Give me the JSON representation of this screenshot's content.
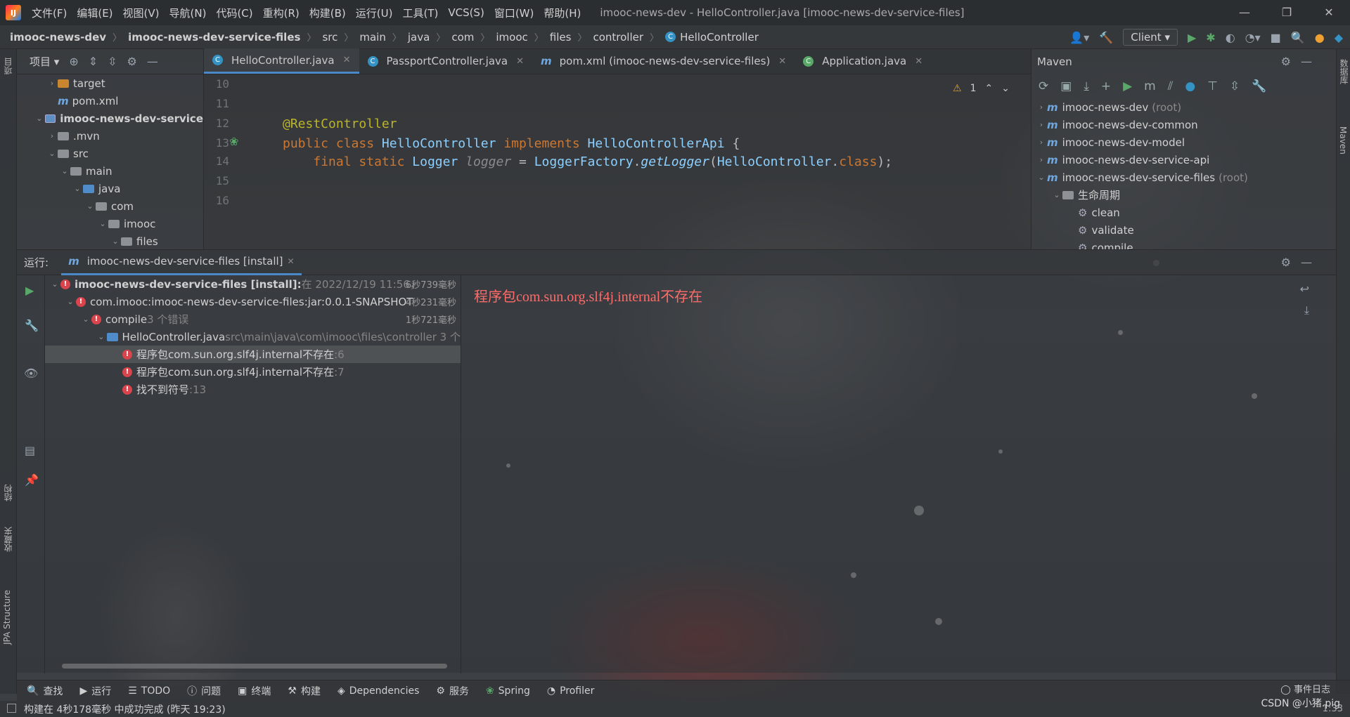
{
  "menubar": {
    "logo": "IJ",
    "items": [
      "文件(F)",
      "编辑(E)",
      "视图(V)",
      "导航(N)",
      "代码(C)",
      "重构(R)",
      "构建(B)",
      "运行(U)",
      "工具(T)",
      "VCS(S)",
      "窗口(W)",
      "帮助(H)"
    ],
    "title": "imooc-news-dev - HelloController.java [imooc-news-dev-service-files]"
  },
  "breadcrumb": [
    "imooc-news-dev",
    "imooc-news-dev-service-files",
    "src",
    "main",
    "java",
    "com",
    "imooc",
    "files",
    "controller",
    "HelloController"
  ],
  "run_config": "Client",
  "left_strip": {
    "project": "项目",
    "structure": "结构",
    "favorites": "收藏夹",
    "jpa": "JPA Structure"
  },
  "right_strip": {
    "database": "数据库",
    "maven": "Maven"
  },
  "project_panel": {
    "title": "项目",
    "rows": [
      {
        "label": "target",
        "icon": "folder-orange",
        "arrow": "›",
        "indent": 2
      },
      {
        "label": "pom.xml",
        "icon": "maven-file",
        "arrow": "",
        "indent": 2
      },
      {
        "label": "imooc-news-dev-service",
        "icon": "module-folder",
        "arrow": "⌄",
        "indent": 1
      },
      {
        "label": ".mvn",
        "icon": "folder-gray",
        "arrow": "›",
        "indent": 2
      },
      {
        "label": "src",
        "icon": "folder-gray",
        "arrow": "⌄",
        "indent": 2
      },
      {
        "label": "main",
        "icon": "folder-gray",
        "arrow": "⌄",
        "indent": 3
      },
      {
        "label": "java",
        "icon": "folder-blue",
        "arrow": "⌄",
        "indent": 4
      },
      {
        "label": "com",
        "icon": "folder-gray",
        "arrow": "⌄",
        "indent": 5
      },
      {
        "label": "imooc",
        "icon": "folder-gray",
        "arrow": "⌄",
        "indent": 6
      },
      {
        "label": "files",
        "icon": "folder-gray",
        "arrow": "⌄",
        "indent": 7
      }
    ]
  },
  "editor": {
    "tabs": [
      "HelloController.java",
      "PassportController.java",
      "pom.xml (imooc-news-dev-service-files)",
      "Application.java"
    ],
    "line_numbers": [
      "10",
      "11",
      "12",
      "13",
      "14",
      "15",
      "16"
    ],
    "code": {
      "annotation": "@RestController",
      "l13_kw1": "public",
      "l13_kw2": "class",
      "l13_name": "HelloController",
      "l13_kw3": "implements",
      "l13_iface": "HelloControllerApi",
      "l13_brace": " {",
      "l14_kw1": "final",
      "l14_kw2": "static",
      "l14_type": "Logger",
      "l14_var": "logger",
      "l14_eq": " = ",
      "l14_factory": "LoggerFactory",
      "l14_dot": ".",
      "l14_method": "getLogger",
      "l14_paren": "(",
      "l14_arg": "HelloController",
      "l14_dot2": ".",
      "l14_class": "class",
      "l14_end": ");"
    },
    "warning_count": "1"
  },
  "maven": {
    "title": "Maven",
    "rows": [
      {
        "label": "imooc-news-dev",
        "suffix": "(root)",
        "indent": 0,
        "arrow": "›"
      },
      {
        "label": "imooc-news-dev-common",
        "suffix": "",
        "indent": 0,
        "arrow": "›"
      },
      {
        "label": "imooc-news-dev-model",
        "suffix": "",
        "indent": 0,
        "arrow": "›"
      },
      {
        "label": "imooc-news-dev-service-api",
        "suffix": "",
        "indent": 0,
        "arrow": "›"
      },
      {
        "label": "imooc-news-dev-service-files",
        "suffix": "(root)",
        "indent": 0,
        "arrow": "⌄"
      },
      {
        "label": "生命周期",
        "suffix": "",
        "indent": 1,
        "arrow": "⌄"
      },
      {
        "label": "clean",
        "suffix": "",
        "indent": 2,
        "arrow": ""
      },
      {
        "label": "validate",
        "suffix": "",
        "indent": 2,
        "arrow": ""
      },
      {
        "label": "compile",
        "suffix": "",
        "indent": 2,
        "arrow": ""
      }
    ]
  },
  "run_panel": {
    "label": "运行:",
    "tab": "imooc-news-dev-service-files [install]",
    "tree": [
      {
        "text": "imooc-news-dev-service-files [install]:",
        "extra": " 在 2022/12/19 11:56，",
        "time": "6秒739毫秒",
        "indent": 0,
        "bold": true
      },
      {
        "text": "com.imooc:imooc-news-dev-service-files:jar:0.0.1-SNAPSHOT",
        "extra": "",
        "time": "4秒231毫秒",
        "indent": 1,
        "bold": false
      },
      {
        "text": "compile",
        "extra": " 3 个错误",
        "time": "1秒721毫秒",
        "indent": 2,
        "bold": false
      },
      {
        "text": "HelloController.java",
        "extra": " src\\main\\java\\com\\imooc\\files\\controller 3 个",
        "time": "",
        "indent": 3,
        "bold": false
      },
      {
        "text": "程序包com.sun.org.slf4j.internal不存在",
        "extra": " :6",
        "time": "",
        "indent": 4,
        "bold": false
      },
      {
        "text": "程序包com.sun.org.slf4j.internal不存在",
        "extra": " :7",
        "time": "",
        "indent": 4,
        "bold": false
      },
      {
        "text": "找不到符号",
        "extra": " :13",
        "time": "",
        "indent": 4,
        "bold": false
      }
    ],
    "console_message": "程序包com.sun.org.slf4j.internal不存在"
  },
  "bottom_tools": [
    "查找",
    "运行",
    "TODO",
    "问题",
    "终端",
    "构建",
    "Dependencies",
    "服务",
    "Spring",
    "Profiler"
  ],
  "event_log": "事件日志",
  "status": {
    "message": "构建在 4秒178毫秒 中成功完成 (昨天 19:23)",
    "position": "1:33"
  },
  "watermark": "CSDN @小猪.pig",
  "colors": {
    "error": "#d9444d",
    "console_error": "#ff6b68",
    "keyword": "#cc7832",
    "annotation": "#bbb529",
    "type": "#8bd0ff",
    "accent": "#4a88c7"
  }
}
